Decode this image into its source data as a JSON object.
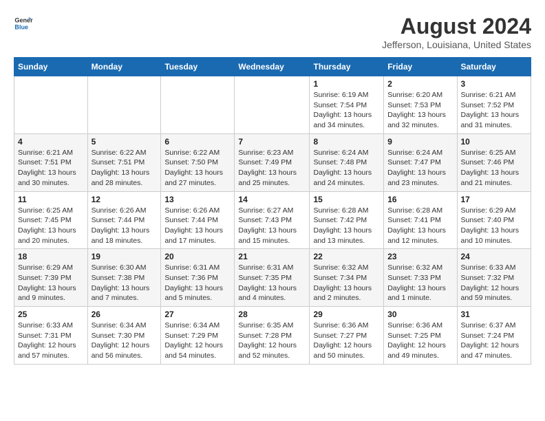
{
  "logo": {
    "line1": "General",
    "line2": "Blue"
  },
  "title": "August 2024",
  "subtitle": "Jefferson, Louisiana, United States",
  "weekdays": [
    "Sunday",
    "Monday",
    "Tuesday",
    "Wednesday",
    "Thursday",
    "Friday",
    "Saturday"
  ],
  "weeks": [
    [
      {
        "day": "",
        "info": ""
      },
      {
        "day": "",
        "info": ""
      },
      {
        "day": "",
        "info": ""
      },
      {
        "day": "",
        "info": ""
      },
      {
        "day": "1",
        "info": "Sunrise: 6:19 AM\nSunset: 7:54 PM\nDaylight: 13 hours\nand 34 minutes."
      },
      {
        "day": "2",
        "info": "Sunrise: 6:20 AM\nSunset: 7:53 PM\nDaylight: 13 hours\nand 32 minutes."
      },
      {
        "day": "3",
        "info": "Sunrise: 6:21 AM\nSunset: 7:52 PM\nDaylight: 13 hours\nand 31 minutes."
      }
    ],
    [
      {
        "day": "4",
        "info": "Sunrise: 6:21 AM\nSunset: 7:51 PM\nDaylight: 13 hours\nand 30 minutes."
      },
      {
        "day": "5",
        "info": "Sunrise: 6:22 AM\nSunset: 7:51 PM\nDaylight: 13 hours\nand 28 minutes."
      },
      {
        "day": "6",
        "info": "Sunrise: 6:22 AM\nSunset: 7:50 PM\nDaylight: 13 hours\nand 27 minutes."
      },
      {
        "day": "7",
        "info": "Sunrise: 6:23 AM\nSunset: 7:49 PM\nDaylight: 13 hours\nand 25 minutes."
      },
      {
        "day": "8",
        "info": "Sunrise: 6:24 AM\nSunset: 7:48 PM\nDaylight: 13 hours\nand 24 minutes."
      },
      {
        "day": "9",
        "info": "Sunrise: 6:24 AM\nSunset: 7:47 PM\nDaylight: 13 hours\nand 23 minutes."
      },
      {
        "day": "10",
        "info": "Sunrise: 6:25 AM\nSunset: 7:46 PM\nDaylight: 13 hours\nand 21 minutes."
      }
    ],
    [
      {
        "day": "11",
        "info": "Sunrise: 6:25 AM\nSunset: 7:45 PM\nDaylight: 13 hours\nand 20 minutes."
      },
      {
        "day": "12",
        "info": "Sunrise: 6:26 AM\nSunset: 7:44 PM\nDaylight: 13 hours\nand 18 minutes."
      },
      {
        "day": "13",
        "info": "Sunrise: 6:26 AM\nSunset: 7:44 PM\nDaylight: 13 hours\nand 17 minutes."
      },
      {
        "day": "14",
        "info": "Sunrise: 6:27 AM\nSunset: 7:43 PM\nDaylight: 13 hours\nand 15 minutes."
      },
      {
        "day": "15",
        "info": "Sunrise: 6:28 AM\nSunset: 7:42 PM\nDaylight: 13 hours\nand 13 minutes."
      },
      {
        "day": "16",
        "info": "Sunrise: 6:28 AM\nSunset: 7:41 PM\nDaylight: 13 hours\nand 12 minutes."
      },
      {
        "day": "17",
        "info": "Sunrise: 6:29 AM\nSunset: 7:40 PM\nDaylight: 13 hours\nand 10 minutes."
      }
    ],
    [
      {
        "day": "18",
        "info": "Sunrise: 6:29 AM\nSunset: 7:39 PM\nDaylight: 13 hours\nand 9 minutes."
      },
      {
        "day": "19",
        "info": "Sunrise: 6:30 AM\nSunset: 7:38 PM\nDaylight: 13 hours\nand 7 minutes."
      },
      {
        "day": "20",
        "info": "Sunrise: 6:31 AM\nSunset: 7:36 PM\nDaylight: 13 hours\nand 5 minutes."
      },
      {
        "day": "21",
        "info": "Sunrise: 6:31 AM\nSunset: 7:35 PM\nDaylight: 13 hours\nand 4 minutes."
      },
      {
        "day": "22",
        "info": "Sunrise: 6:32 AM\nSunset: 7:34 PM\nDaylight: 13 hours\nand 2 minutes."
      },
      {
        "day": "23",
        "info": "Sunrise: 6:32 AM\nSunset: 7:33 PM\nDaylight: 13 hours\nand 1 minute."
      },
      {
        "day": "24",
        "info": "Sunrise: 6:33 AM\nSunset: 7:32 PM\nDaylight: 12 hours\nand 59 minutes."
      }
    ],
    [
      {
        "day": "25",
        "info": "Sunrise: 6:33 AM\nSunset: 7:31 PM\nDaylight: 12 hours\nand 57 minutes."
      },
      {
        "day": "26",
        "info": "Sunrise: 6:34 AM\nSunset: 7:30 PM\nDaylight: 12 hours\nand 56 minutes."
      },
      {
        "day": "27",
        "info": "Sunrise: 6:34 AM\nSunset: 7:29 PM\nDaylight: 12 hours\nand 54 minutes."
      },
      {
        "day": "28",
        "info": "Sunrise: 6:35 AM\nSunset: 7:28 PM\nDaylight: 12 hours\nand 52 minutes."
      },
      {
        "day": "29",
        "info": "Sunrise: 6:36 AM\nSunset: 7:27 PM\nDaylight: 12 hours\nand 50 minutes."
      },
      {
        "day": "30",
        "info": "Sunrise: 6:36 AM\nSunset: 7:25 PM\nDaylight: 12 hours\nand 49 minutes."
      },
      {
        "day": "31",
        "info": "Sunrise: 6:37 AM\nSunset: 7:24 PM\nDaylight: 12 hours\nand 47 minutes."
      }
    ]
  ]
}
